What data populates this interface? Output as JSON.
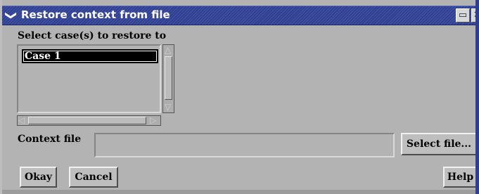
{
  "window": {
    "title": "Restore context from file",
    "menu_icon": "chevron-down-icon",
    "maximize_icon": "maximize-icon",
    "close_icon": "close-icon",
    "menu_glyph": "❯",
    "maximize_glyph": "▭",
    "close_glyph": "✕"
  },
  "cases": {
    "label": "Select case(s) to restore to",
    "items": [
      "Case 1"
    ],
    "selected": "Case 1"
  },
  "context": {
    "label": "Context file",
    "value": "",
    "select_button": "Select file..."
  },
  "actions": {
    "okay": "Okay",
    "cancel": "Cancel",
    "help": "Help"
  },
  "colors": {
    "titlebar": "#2f3f93",
    "dialog_background": "#b3b3b3",
    "selection": "#000000"
  }
}
